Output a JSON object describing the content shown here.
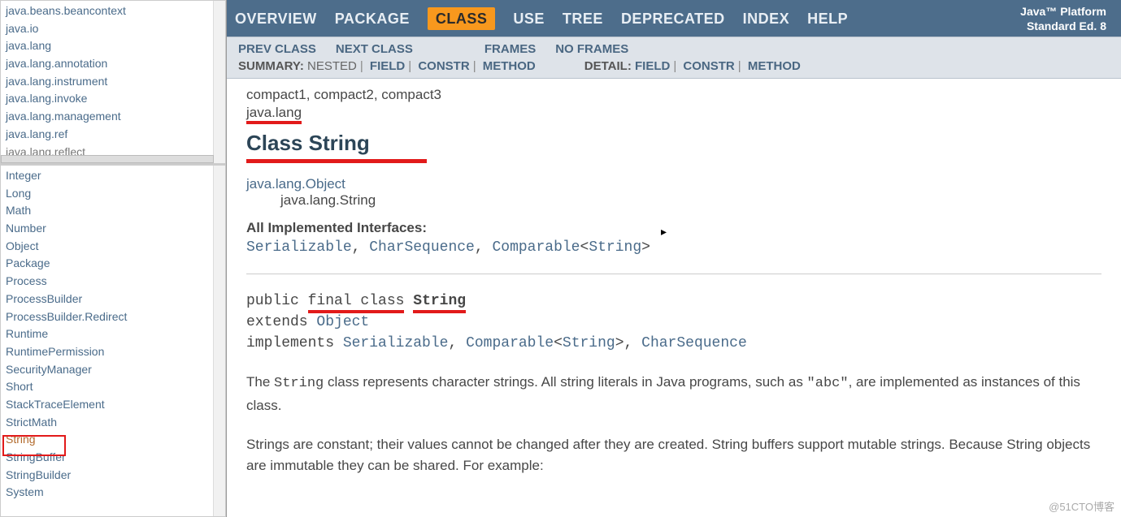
{
  "platform": {
    "line1": "Java™ Platform",
    "line2": "Standard Ed. 8"
  },
  "nav": {
    "items": [
      "OVERVIEW",
      "PACKAGE",
      "CLASS",
      "USE",
      "TREE",
      "DEPRECATED",
      "INDEX",
      "HELP"
    ],
    "active_index": 2
  },
  "subnav": {
    "prev": "PREV CLASS",
    "next": "NEXT CLASS",
    "frames": "FRAMES",
    "noframes": "NO FRAMES",
    "summary_label": "SUMMARY:",
    "summary_nested": "NESTED",
    "summary_field": "FIELD",
    "summary_constr": "CONSTR",
    "summary_method": "METHOD",
    "detail_label": "DETAIL:",
    "detail_field": "FIELD",
    "detail_constr": "CONSTR",
    "detail_method": "METHOD"
  },
  "packages": [
    "java.beans.beancontext",
    "java.io",
    "java.lang",
    "java.lang.annotation",
    "java.lang.instrument",
    "java.lang.invoke",
    "java.lang.management",
    "java.lang.ref",
    "java.lang.reflect"
  ],
  "classes": [
    "Integer",
    "Long",
    "Math",
    "Number",
    "Object",
    "Package",
    "Process",
    "ProcessBuilder",
    "ProcessBuilder.Redirect",
    "Runtime",
    "RuntimePermission",
    "SecurityManager",
    "Short",
    "StackTraceElement",
    "StrictMath",
    "String",
    "StringBuffer",
    "StringBuilder",
    "System"
  ],
  "selected_class": "String",
  "doc": {
    "profiles": "compact1, compact2, compact3",
    "package": "java.lang",
    "title": "Class String",
    "super": "java.lang.Object",
    "this": "java.lang.String",
    "iface_label": "All Implemented Interfaces:",
    "ifaces": {
      "serializable": "Serializable",
      "charsequence": "CharSequence",
      "comparable": "Comparable",
      "param": "String"
    },
    "sig": {
      "public": "public ",
      "final_class": "final class",
      "space": " ",
      "name": "String",
      "extends": "extends ",
      "object": "Object",
      "implements": "implements ",
      "serializable": "Serializable",
      "comma1": ", ",
      "comparable": "Comparable",
      "lt": "<",
      "param": "String",
      "gt": ">",
      "comma2": ", ",
      "charsequence": "CharSequence"
    },
    "para1a": "The ",
    "para1code": "String",
    "para1b": " class represents character strings. All string literals in Java programs, such as ",
    "para1lit": "\"abc\"",
    "para1c": ", are implemented as instances of this class.",
    "para2": "Strings are constant; their values cannot be changed after they are created. String buffers support mutable strings. Because String objects are immutable they can be shared. For example:"
  },
  "watermark": "@51CTO博客"
}
